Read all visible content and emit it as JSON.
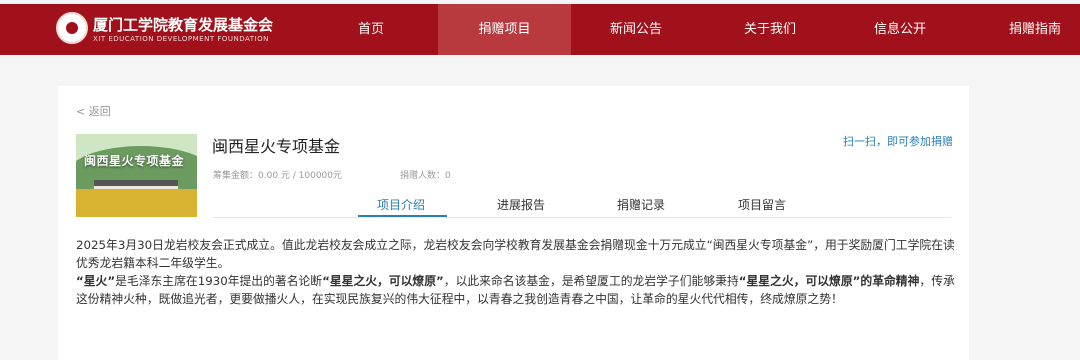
{
  "brand": {
    "title": "厦门工学院教育发展基金会",
    "subtitle": "XIT EDUCATION DEVELOPMENT FOUNDATION"
  },
  "nav": [
    {
      "label": "首页",
      "active": false
    },
    {
      "label": "捐赠项目",
      "active": true
    },
    {
      "label": "新闻公告",
      "active": false
    },
    {
      "label": "关于我们",
      "active": false
    },
    {
      "label": "信息公开",
      "active": false
    },
    {
      "label": "捐赠指南",
      "active": false
    }
  ],
  "back": "< 返回",
  "project": {
    "image_text": "闽西星火专项基金",
    "title": "闽西星火专项基金",
    "raised": "筹集金额：0.00 元 / 100000元",
    "donors": "捐赠人数：0",
    "scan": "扫一扫，即可参加捐赠"
  },
  "tabs": [
    "项目介绍",
    "进展报告",
    "捐赠记录",
    "项目留言"
  ],
  "content": {
    "p1": "2025年3月30日龙岩校友会正式成立。值此龙岩校友会成立之际，龙岩校友会向学校教育发展基金会捐赠现金十万元成立“闽西星火专项基金”，用于奖励厦门工学院在读优秀龙岩籍本科二年级学生。",
    "p2_a": "“星火”",
    "p2_b": "是毛泽东主席在1930年提出的著名论断",
    "p2_c": "“星星之火，可以燎原”",
    "p2_d": "，以此来命名该基金，是希望厦工的龙岩学子们能够秉持",
    "p2_e": "“星星之火，可以燎原”",
    "p2_f": "的革命精神",
    "p2_g": "，传承这份精神火种，既做追光者，更要做播火人，在实现民族复兴的伟大征程中，以青春之我创造青春之中国，让革命的星火代代相传，终成燎原之势！"
  },
  "colors": {
    "brand_red": "#a0111b",
    "active_nav": "#b83a3f",
    "accent_blue": "#2a7fb8"
  }
}
